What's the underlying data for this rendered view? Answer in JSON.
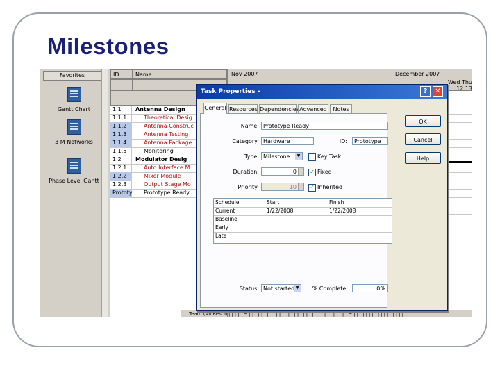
{
  "slide": {
    "title": "Milestones"
  },
  "sidebar": {
    "header": "Favorites",
    "views": [
      {
        "label": "Gantt Chart",
        "icon": "gantt-chart-icon"
      },
      {
        "label": "3 M Networks",
        "icon": "network-view-icon"
      },
      {
        "label": "Phase Level Gantt",
        "icon": "phase-gantt-icon"
      }
    ]
  },
  "task_grid": {
    "col_id": "ID",
    "col_name": "Name",
    "rows": [
      {
        "id": "1.1",
        "name": "Antenna Design",
        "summary": true,
        "selected": false,
        "red": false
      },
      {
        "id": "1.1.1",
        "name": "Theoretical Desig",
        "summary": false,
        "selected": false,
        "red": true
      },
      {
        "id": "1.1.2",
        "name": "Antenna Construc",
        "summary": false,
        "selected": true,
        "red": true
      },
      {
        "id": "1.1.3",
        "name": "Antenna Testing",
        "summary": false,
        "selected": true,
        "red": true
      },
      {
        "id": "1.1.4",
        "name": "Antenna Package",
        "summary": false,
        "selected": true,
        "red": true
      },
      {
        "id": "1.1.5",
        "name": "Monitoring",
        "summary": false,
        "selected": false,
        "red": false
      },
      {
        "id": "1.2",
        "name": "Modulator Desig",
        "summary": true,
        "selected": false,
        "red": false
      },
      {
        "id": "1.2.1",
        "name": "Auto Interface M",
        "summary": false,
        "selected": false,
        "red": true
      },
      {
        "id": "1.2.2",
        "name": "Mixer Module",
        "summary": false,
        "selected": true,
        "red": true
      },
      {
        "id": "1.2.3",
        "name": "Output Stage Mo",
        "summary": false,
        "selected": false,
        "red": true
      },
      {
        "id": "Prototy",
        "name": "Prototype Ready",
        "summary": false,
        "selected": true,
        "red": false
      }
    ],
    "footer": "Team (All Resources"
  },
  "gantt": {
    "month1": "Nov 2007",
    "month2": "December 2007",
    "days_top": "Wed Thu",
    "days_bottom": "12 13",
    "footer_ticks": "|||| ~|| |||| |||| |||| |||| |||| |||| ~|| |||| |||| ||||"
  },
  "dialog": {
    "title": "Task Properties -",
    "help_glyph": "?",
    "close_glyph": "✕",
    "tabs": [
      "General",
      "Resources",
      "Dependencies",
      "Advanced",
      "Notes"
    ],
    "labels": {
      "name": "Name:",
      "category": "Category:",
      "id": "ID:",
      "type": "Type:",
      "key_task": "Key Task",
      "duration": "Duration:",
      "fixed": "Fixed",
      "priority": "Priority:",
      "inherited": "Inherited",
      "status": "Status:",
      "pct_complete": "% Complete:"
    },
    "values": {
      "name": "Prototype Ready",
      "category": "Hardware",
      "id": "Prototype",
      "type": "Milestone",
      "duration": "0",
      "priority": "10",
      "status": "Not started",
      "pct_complete": "0%"
    },
    "checks": {
      "key_task": false,
      "fixed": true,
      "inherited": true
    },
    "schedule": {
      "headers": [
        "Schedule",
        "Start",
        "Finish"
      ],
      "rows": [
        [
          "Current",
          "1/22/2008",
          "1/22/2008"
        ],
        [
          "Baseline",
          "",
          ""
        ],
        [
          "Early",
          "",
          ""
        ],
        [
          "Late",
          "",
          ""
        ]
      ]
    },
    "buttons": {
      "ok": "OK",
      "cancel": "Cancel",
      "help": "Help"
    }
  }
}
